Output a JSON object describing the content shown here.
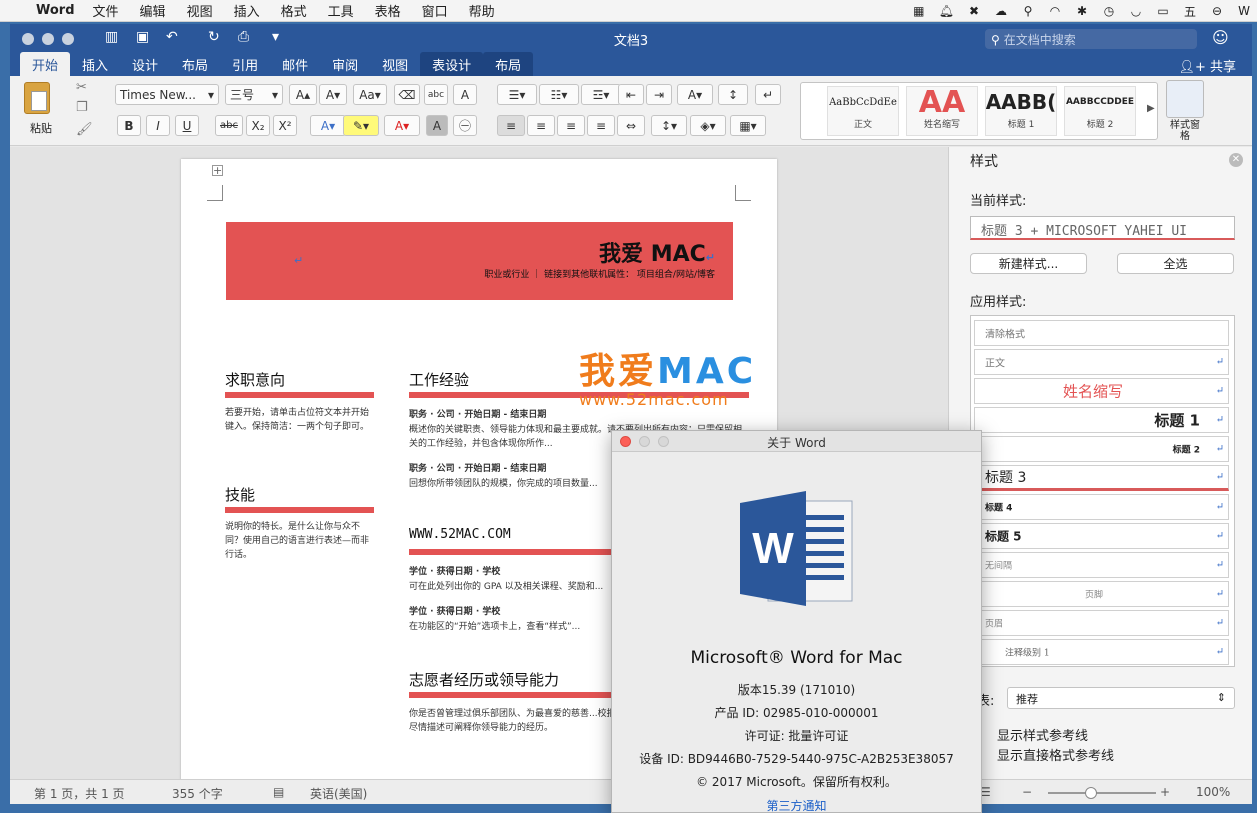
{
  "menubar": {
    "app": "Word",
    "items": [
      "文件",
      "编辑",
      "视图",
      "插入",
      "格式",
      "工具",
      "表格",
      "窗口",
      "帮助"
    ],
    "status_icons": [
      "grid-icon",
      "bell-icon",
      "cross-app-icon",
      "cloud-icon",
      "search-tool-icon",
      "wifi-tool-icon",
      "settings-tool-icon",
      "history-icon",
      "wifi-icon",
      "battery-icon",
      "input-method-icon",
      "minus-circle-icon"
    ],
    "input_method": "五",
    "user_initial": "W"
  },
  "window": {
    "title": "文档3",
    "search_placeholder": "在文档中搜索",
    "share_label": "共享",
    "tabs": [
      "开始",
      "插入",
      "设计",
      "布局",
      "引用",
      "邮件",
      "审阅",
      "视图",
      "表设计",
      "布局"
    ]
  },
  "ribbon": {
    "paste_label": "粘贴",
    "font_name": "Times New...",
    "font_size": "三号",
    "style_gallery": [
      {
        "preview": "AaBbCcDdEe",
        "name": "正文"
      },
      {
        "preview": "AA",
        "name": "姓名缩写"
      },
      {
        "preview": "AABB(",
        "name": "标题 1"
      },
      {
        "preview": "AABBCCDDEE",
        "name": "标题 2"
      }
    ],
    "style_pane_label": "样式窗格",
    "format_buttons": [
      "B",
      "I",
      "U",
      "abc",
      "X₂",
      "X²"
    ]
  },
  "document": {
    "banner_title": "我爱 MAC",
    "banner_subtitle": "职业或行业 ｜ 链接到其他联机属性： 项目组合/网站/博客",
    "sections": {
      "objective": {
        "heading": "求职意向",
        "body": "若要开始，请单击占位符文本并开始键入。保持简洁：一两个句子即可。"
      },
      "skills": {
        "heading": "技能",
        "body": "说明你的特长。是什么让你与众不同？使用自己的语言进行表述—而非行话。"
      },
      "experience": {
        "heading": "工作经验",
        "job1_title": "职务 · 公司 · 开始日期 - 结束日期",
        "job1_body": "概述你的关键职责、领导能力体现和最主要成就。请不要列出所有内容；只需保留相关的工作经验，并包含体现你所作...",
        "job2_title": "职务 · 公司 · 开始日期 - 结束日期",
        "job2_body": "回想你所带领团队的规模，你完成的项目数量..."
      },
      "education": {
        "heading": "WWW.52MAC.COM",
        "edu1_title": "学位 · 获得日期 · 学校",
        "edu1_body": "可在此处列出你的 GPA 以及相关课程、奖励和...",
        "edu2_title": "学位 · 获得日期 · 学校",
        "edu2_body": "在功能区的“开始”选项卡上，查看“样式”..."
      },
      "volunteer": {
        "heading": "志愿者经历或领导能力",
        "body": "你是否曾管理过俱乐部团队、为最喜爱的慈善...校报？ 请尽情描述可阐释你领导能力的经历。"
      }
    },
    "watermark": {
      "chinese": "我爱",
      "latin": "MAC",
      "url": "www.52mac.com"
    }
  },
  "statusbar": {
    "page": "第 1 页，共 1 页",
    "words": "355 个字",
    "language": "英语(美国)",
    "zoom": "100%",
    "zoom_fraction": 0.4
  },
  "styles_pane": {
    "title": "样式",
    "current_label": "当前样式:",
    "current_value": "标题 3 + MICROSOFT YAHEI UI",
    "new_style_button": "新建样式...",
    "select_all_button": "全选",
    "apply_label": "应用样式:",
    "styles": [
      {
        "name": "清除格式",
        "mark": ""
      },
      {
        "name": "正文",
        "mark": "↵"
      },
      {
        "name": "姓名缩写",
        "mark": "↵"
      },
      {
        "name": "标题 1",
        "mark": "↵"
      },
      {
        "name": "标题 2",
        "mark": "↵"
      },
      {
        "name": "标题 3",
        "mark": "↵"
      },
      {
        "name": "标题 4",
        "mark": "↵"
      },
      {
        "name": "标题 5",
        "mark": "↵"
      },
      {
        "name": "无间隔",
        "mark": "↵"
      },
      {
        "name": "页脚",
        "mark": "↵"
      },
      {
        "name": "页眉",
        "mark": "↵"
      },
      {
        "name": "注释级别 1",
        "mark": "↵"
      }
    ],
    "list_label": "表:",
    "list_value": "推荐",
    "show_guides": "显示样式参考线",
    "show_direct_guides": "显示直接格式参考线"
  },
  "about": {
    "title": "关于 Word",
    "product": "Microsoft® Word for Mac",
    "version": "版本15.39 (171010)",
    "product_id": "产品 ID: 02985-010-000001",
    "license": "许可证: 批量许可证",
    "device_id": "设备 ID: BD9446B0-7529-5440-975C-A2B253E38057",
    "copyright": "© 2017 Microsoft。保留所有权利。",
    "third_party": "第三方通知"
  },
  "colors": {
    "word_blue": "#2b579a",
    "banner_red": "#e35353",
    "watermark_orange": "#f07c1c",
    "link_blue": "#1b5fc8"
  }
}
